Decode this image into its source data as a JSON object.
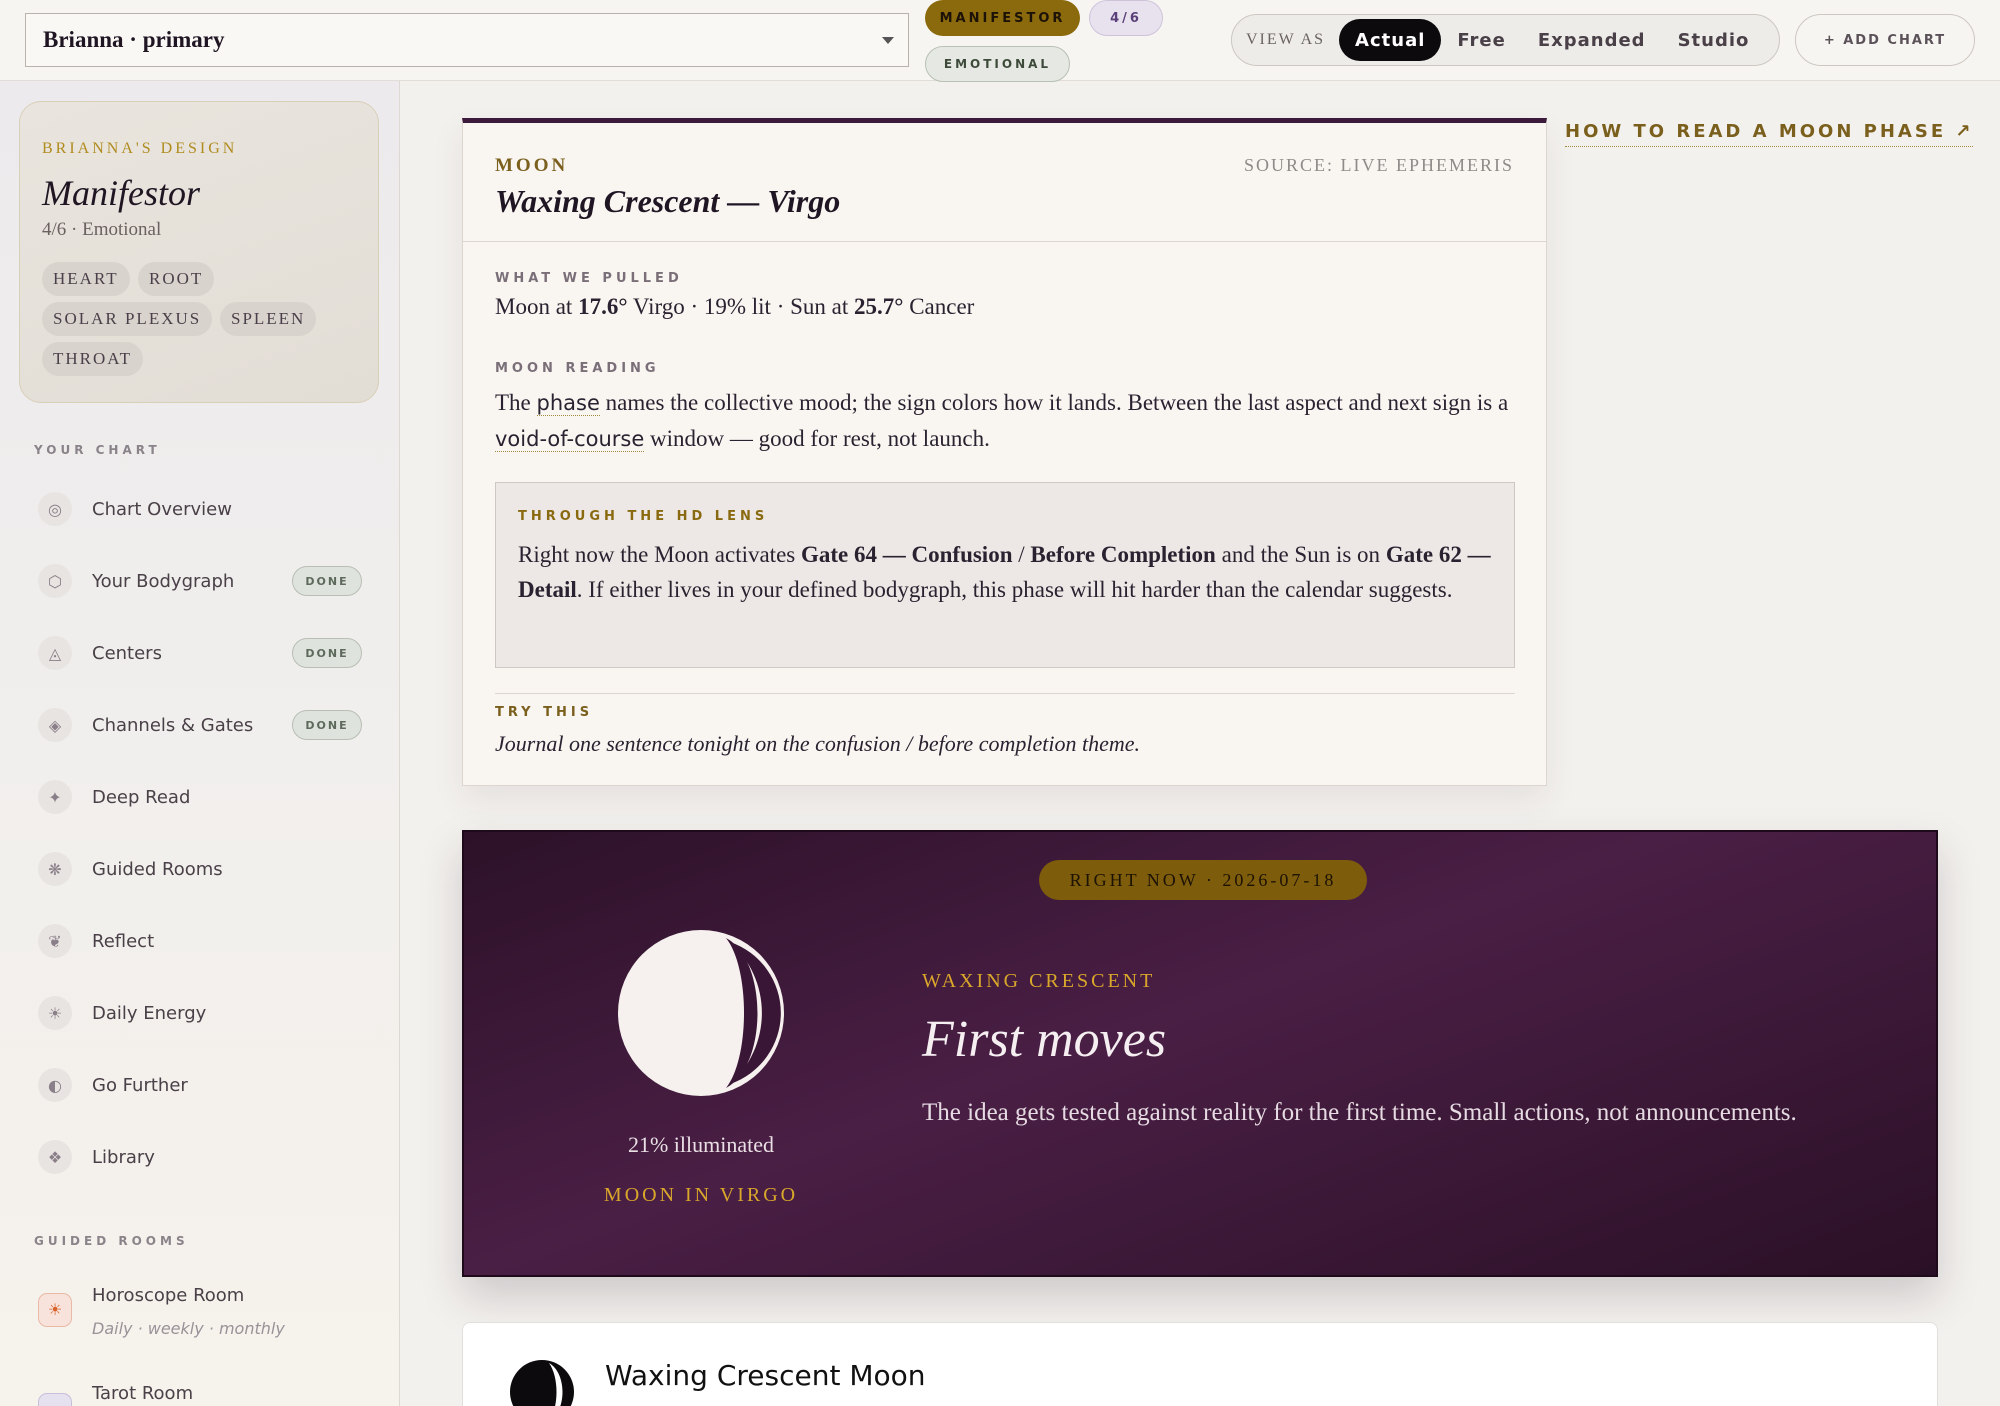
{
  "topbar": {
    "chart_select": "Brianna · primary",
    "pills": {
      "type": "MANIFESTOR",
      "profile": "4/6",
      "authority": "EMOTIONAL"
    },
    "view_as": {
      "label": "VIEW AS",
      "options": [
        "Actual",
        "Free",
        "Expanded",
        "Studio"
      ],
      "active": "Actual"
    },
    "add_chart": "+ ADD CHART"
  },
  "sidebar": {
    "design_card": {
      "eyebrow": "BRIANNA'S DESIGN",
      "type": "Manifestor",
      "sub": "4/6 · Emotional",
      "centers": [
        "HEART",
        "ROOT",
        "SOLAR PLEXUS",
        "SPLEEN",
        "THROAT"
      ]
    },
    "your_chart_label": "YOUR CHART",
    "items": [
      {
        "icon": "target-icon",
        "glyph": "◎",
        "label": "Chart Overview",
        "badge": ""
      },
      {
        "icon": "hexagon-icon",
        "glyph": "⬡",
        "label": "Your Bodygraph",
        "badge": "DONE"
      },
      {
        "icon": "triangle-icon",
        "glyph": "◬",
        "label": "Centers",
        "badge": "DONE"
      },
      {
        "icon": "diamond-icon",
        "glyph": "◈",
        "label": "Channels & Gates",
        "badge": "DONE"
      },
      {
        "icon": "sparkle-icon",
        "glyph": "✦",
        "label": "Deep Read",
        "badge": ""
      },
      {
        "icon": "asterisk-icon",
        "glyph": "❋",
        "label": "Guided Rooms",
        "badge": ""
      },
      {
        "icon": "heart-icon",
        "glyph": "❦",
        "label": "Reflect",
        "badge": ""
      },
      {
        "icon": "sun-icon",
        "glyph": "☀",
        "label": "Daily Energy",
        "badge": ""
      },
      {
        "icon": "half-moon-icon",
        "glyph": "◐",
        "label": "Go Further",
        "badge": ""
      },
      {
        "icon": "diamond-cross-icon",
        "glyph": "❖",
        "label": "Library",
        "badge": ""
      }
    ],
    "guided_rooms_label": "GUIDED ROOMS",
    "rooms": [
      {
        "label": "Horoscope Room",
        "sub": "Daily · weekly · monthly"
      },
      {
        "label": "Tarot Room",
        "sub": ""
      }
    ]
  },
  "moon_card": {
    "kicker": "MOON",
    "source": "SOURCE: LIVE EPHEMERIS",
    "title": "Waxing Crescent — Virgo",
    "pulled_label": "WHAT WE PULLED",
    "pulled": {
      "p1": "Moon at ",
      "moon_deg": "17.6°",
      "p2": " Virgo · 19% lit · Sun at ",
      "sun_deg": "25.7°",
      "p3": " Cancer"
    },
    "reading_label": "MOON READING",
    "reading": {
      "p1": "The ",
      "term1": "phase",
      "p2": " names the collective mood; the sign colors how it lands. Between the last aspect and next sign is a ",
      "term2": "void-of-course",
      "p3": " window — good for rest, not launch."
    },
    "lens_label": "THROUGH THE HD LENS",
    "lens": {
      "p1": "Right now the Moon activates ",
      "gate1": "Gate 64 — Confusion",
      "sep": " / ",
      "gate1b": "Before Completion",
      "p2": " and the Sun is on ",
      "gate2": "Gate 62 — Detail",
      "p3": ". If either lives in your defined bodygraph, this phase will hit harder than the calendar suggests."
    },
    "try_label": "TRY THIS",
    "try_text": "Journal one sentence tonight on the confusion / before completion theme."
  },
  "howto_link": "HOW TO READ A MOON PHASE ↗",
  "phase_banner": {
    "now": "RIGHT NOW · 2026-07-18",
    "illuminated": "21% illuminated",
    "moon_sign": "MOON IN VIRGO",
    "phase_name": "WAXING CRESCENT",
    "title": "First moves",
    "description": "The idea gets tested against reality for the first time. Small actions, not announcements."
  },
  "bottom_card": {
    "title": "Waxing Crescent Moon"
  },
  "colors": {
    "accent_gold": "#8a6a0c",
    "plum": "#3b1a3b",
    "banner_gold": "#d9a72a"
  }
}
